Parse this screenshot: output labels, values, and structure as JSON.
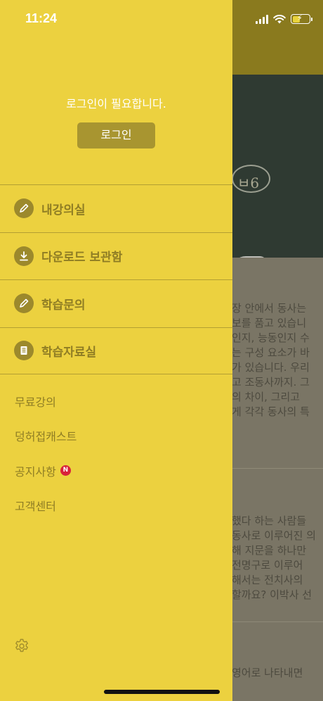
{
  "status_bar": {
    "time": "11:24"
  },
  "drawer": {
    "login_message": "로그인이 필요합니다.",
    "login_button": "로그인",
    "menu_items": [
      {
        "label": "내강의실",
        "icon": "pencil-icon"
      },
      {
        "label": "다운로드 보관함",
        "icon": "download-icon"
      },
      {
        "label": "학습문의",
        "icon": "pencil-icon"
      },
      {
        "label": "학습자료실",
        "icon": "document-icon"
      }
    ],
    "sub_items": [
      {
        "label": "무료강의"
      },
      {
        "label": "덩허접캐스트"
      },
      {
        "label": "공지사항",
        "badge": "N"
      },
      {
        "label": "고객센터"
      }
    ],
    "settings_icon": "gear-icon"
  },
  "background": {
    "chalk_text": "ㅂ6",
    "paragraph_1": [
      "장 안에서 동사는",
      "보를 품고 있습니",
      "인지, 능동인지 수",
      "는 구성 요소가 바",
      "가 있습니다. 우리",
      "고 조동사까지. 그",
      "의 차이, 그리고",
      "게 각각 동사의 특"
    ],
    "paragraph_2": [
      "했다 하는 사람들",
      "동사로 이루어진 의",
      "해 지문을 하나만",
      "전명구로 이루어",
      "해서는 전치사의",
      "할까요? 이박사 선"
    ],
    "paragraph_3": [
      "영어로 나타내면"
    ]
  },
  "colors": {
    "drawer": "#ecd13f",
    "accent": "#a89530",
    "text": "#8f7d24",
    "badge": "#d8223a"
  }
}
